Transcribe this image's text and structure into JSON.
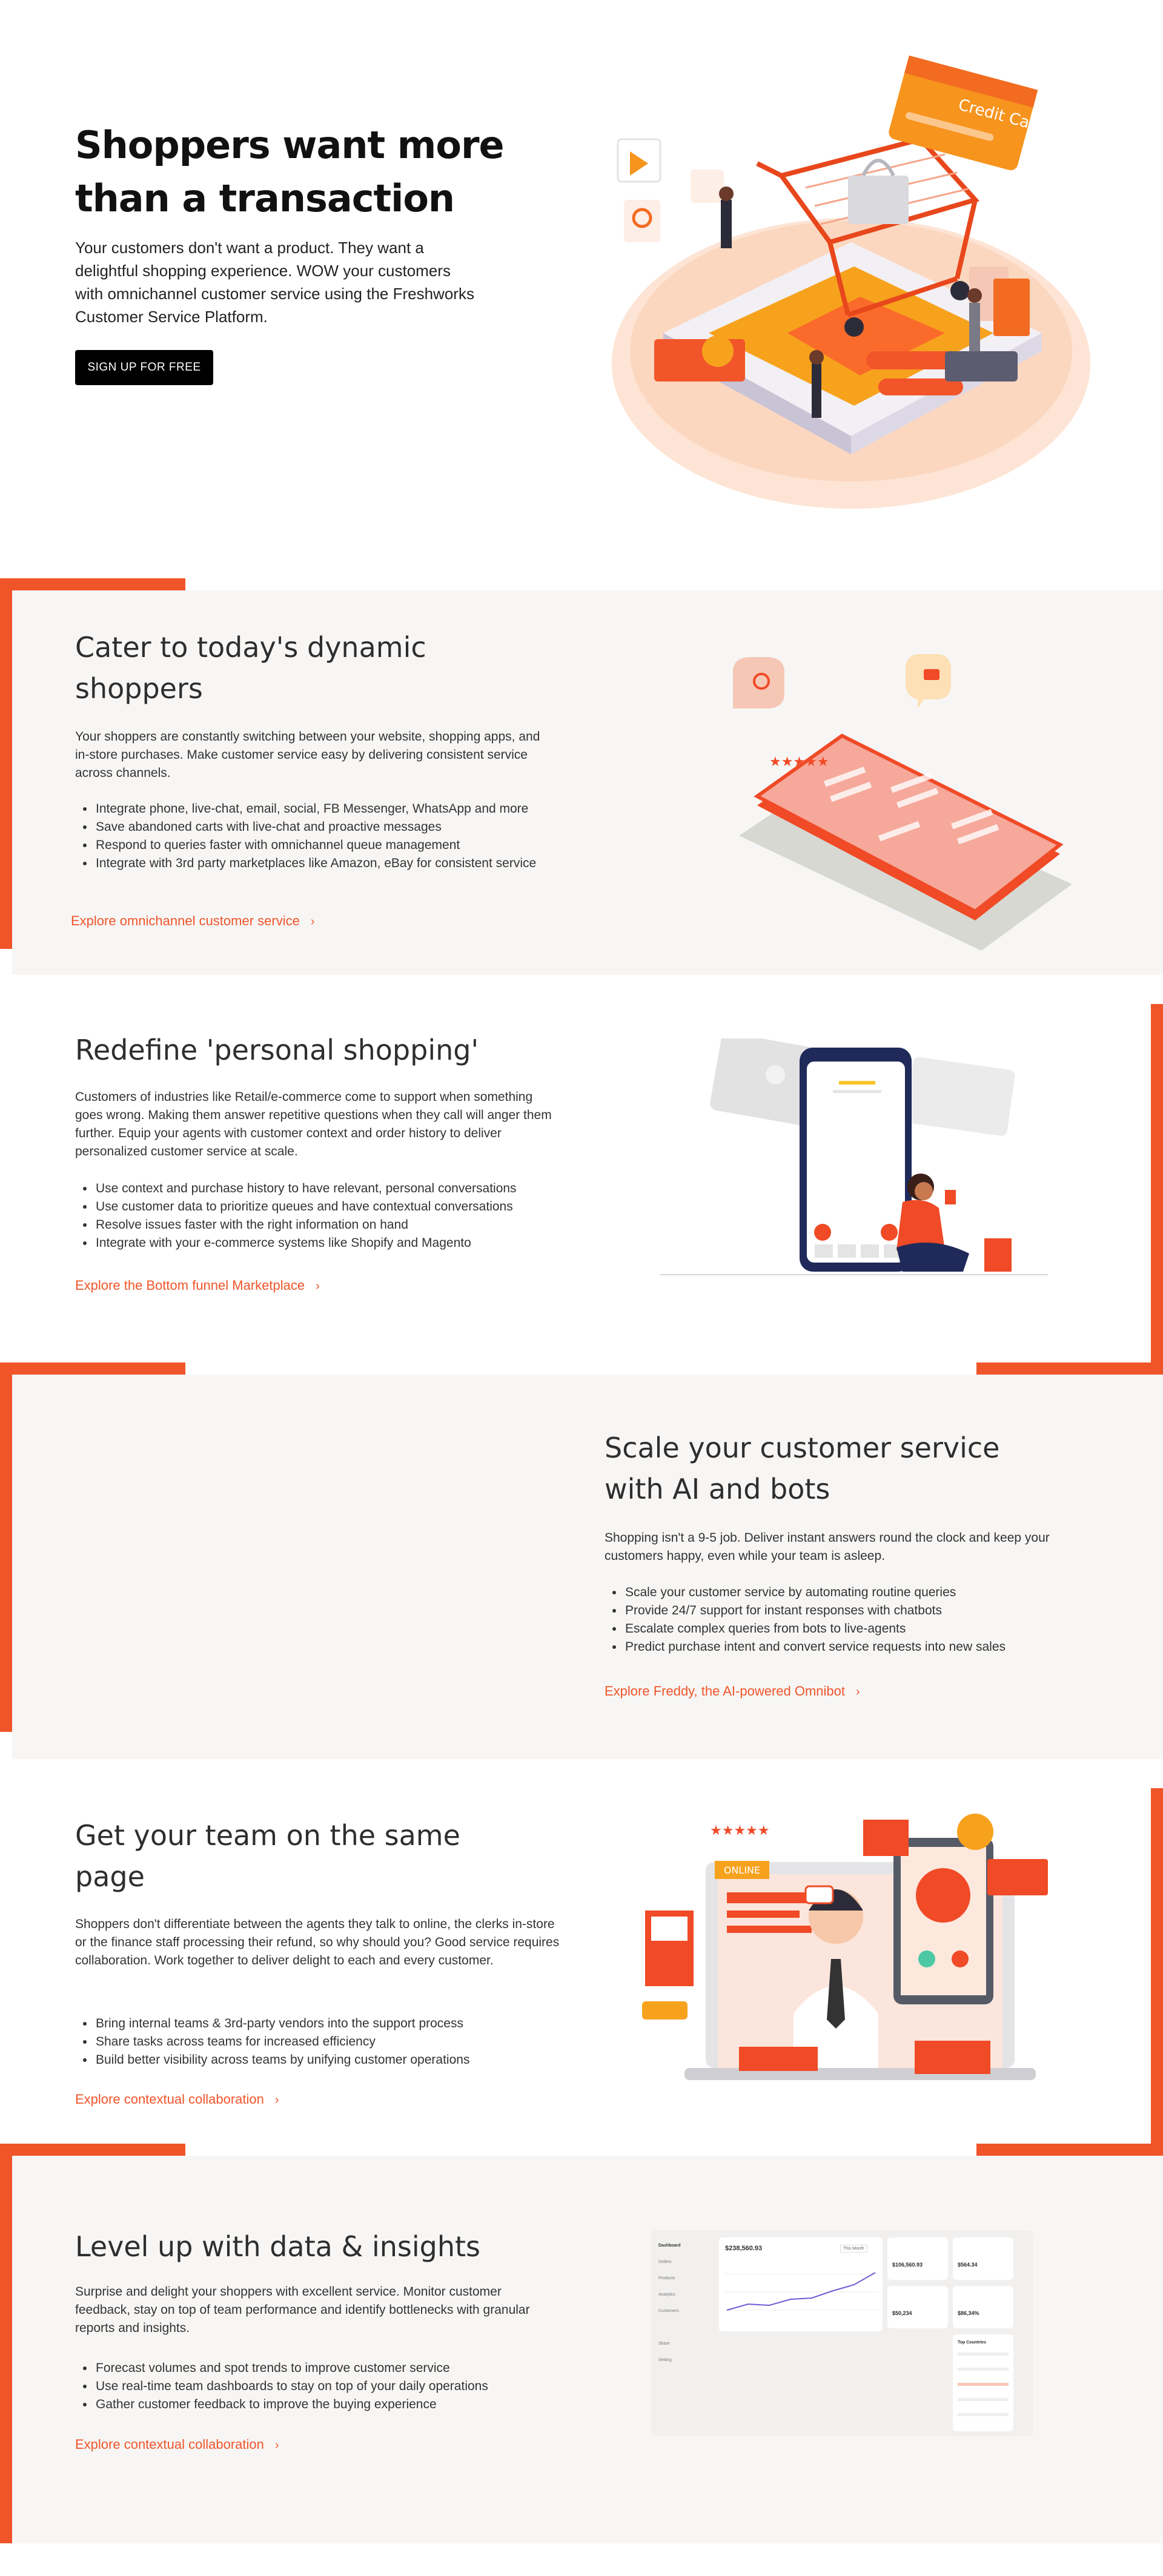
{
  "hero": {
    "title_line1": "Shoppers want more",
    "title_line2": "than a transaction",
    "description": "Your customers don't want a product. They want a delightful shopping experience. WOW your customers with omnichannel customer service using the Freshworks Customer Service Platform.",
    "cta_label": "SIGN UP FOR FREE",
    "card_text": "Credit Card"
  },
  "sections": [
    {
      "title_line1": "Cater to today's dynamic",
      "title_line2": "shoppers",
      "description": "Your shoppers are constantly switching between your website, shopping apps, and in-store purchases. Make customer service easy by delivering consistent service across channels.",
      "bullets": [
        "Integrate phone, live-chat, email, social, FB Messenger, WhatsApp and more",
        "Save abandoned carts with live-chat and proactive messages",
        "Respond to queries faster with omnichannel queue management",
        "Integrate with 3rd party marketplaces like Amazon, eBay for consistent service"
      ],
      "link": "Explore omnichannel customer service"
    },
    {
      "title_line1": "Redefine 'personal shopping'",
      "title_line2": "",
      "description": "Customers of industries like Retail/e-commerce come to support when something goes wrong. Making them answer repetitive questions when they call will anger them further. Equip your agents with customer context and order history to deliver personalized customer service at scale.",
      "bullets": [
        "Use context and purchase history to have relevant, personal conversations",
        "Use customer data to prioritize queues and have contextual conversations",
        "Resolve issues faster with the right information on hand",
        "Integrate with your e-commerce systems like Shopify and Magento"
      ],
      "link": "Explore the Bottom funnel Marketplace"
    },
    {
      "title_line1": "Scale your customer service",
      "title_line2": "with AI and bots",
      "description": "Shopping isn't a 9-5 job. Deliver instant answers round the clock and keep your customers happy, even while your team is asleep.",
      "bullets": [
        "Scale your customer service by automating routine queries",
        "Provide 24/7 support for instant responses with chatbots",
        "Escalate complex queries from bots to live-agents",
        "Predict purchase intent and convert service requests into new sales"
      ],
      "link": "Explore Freddy, the AI-powered Omnibot"
    },
    {
      "title_line1": "Get your team on the same",
      "title_line2": "page",
      "description": "Shoppers don't differentiate between the agents they talk to online, the clerks in-store or the finance staff processing their refund, so why should you? Good service requires collaboration. Work together to deliver delight to each and every customer.",
      "bullets": [
        "Bring internal teams & 3rd-party vendors into the support process",
        "Share tasks across teams for increased efficiency",
        "Build better visibility across teams by unifying customer operations"
      ],
      "link": "Explore contextual collaboration",
      "badge": "ONLINE"
    },
    {
      "title_line1": "Level up with data & insights",
      "title_line2": "",
      "description": "Surprise and delight your shoppers with excellent service. Monitor customer feedback, stay on top of team performance and identify bottlenecks with granular reports and insights.",
      "bullets": [
        "Forecast volumes and spot trends to improve customer service",
        "Use real-time team dashboards to stay on top of your daily operations",
        "Gather customer feedback to improve the buying experience"
      ],
      "link": "Explore contextual collaboration"
    }
  ],
  "dashboard": {
    "nav": [
      "Dashboard",
      "Orders",
      "Products",
      "Analytics",
      "Customers",
      "Share",
      "Setting"
    ],
    "main_value": "$238,560.93",
    "period": "This Month",
    "kpis": [
      "$564.34",
      "$106,560.93",
      "$50,234",
      "$86,34%"
    ],
    "countries_title": "Top Countries"
  },
  "colors": {
    "accent": "#f0552a",
    "band": "#f7f6f5",
    "button": "#000000"
  }
}
